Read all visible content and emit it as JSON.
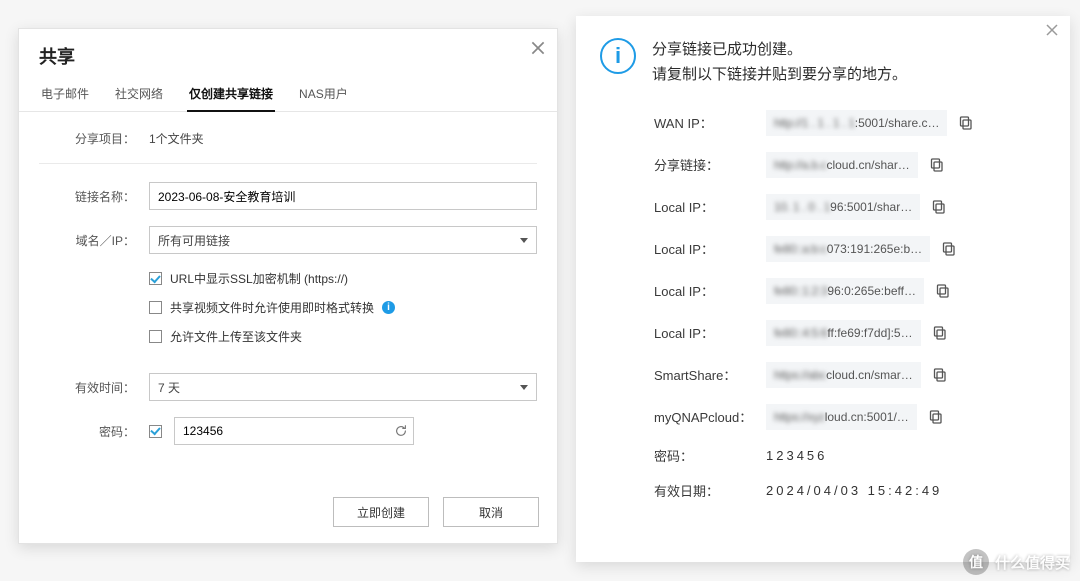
{
  "left": {
    "title": "共享",
    "tabs": [
      "电子邮件",
      "社交网络",
      "仅创建共享链接",
      "NAS用户"
    ],
    "active_tab": 2,
    "labels": {
      "share_item": "分享项目：",
      "link_name": "链接名称：",
      "domain_ip": "域名／IP：",
      "valid_time": "有效时间：",
      "password": "密码："
    },
    "values": {
      "share_item": "1个文件夹",
      "link_name": "2023-06-08-安全教育培训",
      "domain_ip": "所有可用链接",
      "valid_time": "7 天",
      "password": "123456"
    },
    "checks": {
      "ssl_label": "URL中显示SSL加密机制 (https://)",
      "ssl_on": true,
      "transcode_label": "共享视频文件时允许使用即时格式转换",
      "transcode_on": false,
      "upload_label": "允许文件上传至该文件夹",
      "upload_on": false,
      "password_on": true
    },
    "buttons": {
      "create": "立即创建",
      "cancel": "取消"
    }
  },
  "right": {
    "msg_line1": "分享链接已成功创建。",
    "msg_line2": "请复制以下链接并贴到要分享的地方。",
    "rows": [
      {
        "label": "WAN IP：",
        "blur": "http://1 . 1 . 1 . 1",
        "clear": ":5001/share.c…"
      },
      {
        "label": "分享链接：",
        "blur": "http://a.b.c",
        "clear": "cloud.cn/shar…"
      },
      {
        "label": "Local IP：",
        "blur": "10. 1 . 0 . 1",
        "clear": "96:5001/shar…"
      },
      {
        "label": "Local IP：",
        "blur": "fe80::a:b:c",
        "clear": "073:191:265e:b…"
      },
      {
        "label": "Local IP：",
        "blur": "fe80::1:2:3",
        "clear": "96:0:265e:beff…"
      },
      {
        "label": "Local IP：",
        "blur": "fe80::4:5:6",
        "clear": "ff:fe69:f7dd]:5…"
      },
      {
        "label": "SmartShare：",
        "blur": "https://abc",
        "clear": "cloud.cn/smar…"
      },
      {
        "label": "myQNAPcloud：",
        "blur": "https://xyz",
        "clear": "loud.cn:5001/…"
      }
    ],
    "password_label": "密码：",
    "password_value": "123456",
    "expire_label": "有效日期：",
    "expire_value": "2024/04/03 15:42:49"
  },
  "watermark": "什么值得买"
}
